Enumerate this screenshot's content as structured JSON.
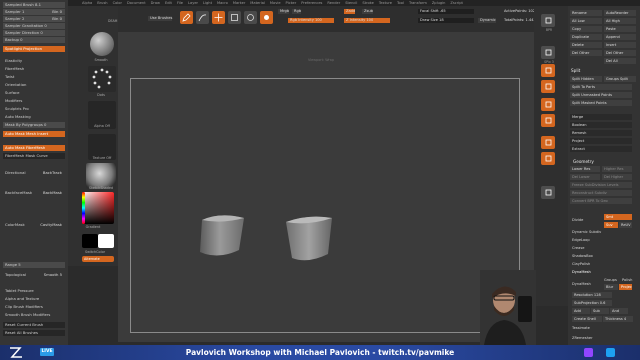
{
  "menu": [
    "Alpha",
    "Brush",
    "Color",
    "Document",
    "Draw",
    "Edit",
    "File",
    "Layer",
    "Light",
    "Macro",
    "Marker",
    "Material",
    "Movie",
    "Picker",
    "Preferences",
    "Render",
    "Stencil",
    "Stroke",
    "Texture",
    "Tool",
    "Transform",
    "Zplugin",
    "Zscript"
  ],
  "left_palette": [
    {
      "label": "Sampled Brush 8.1",
      "style": "slider",
      "value": ""
    },
    {
      "label": "Sampler 1",
      "style": "slider",
      "value": "Bin 0"
    },
    {
      "label": "Sampler 2",
      "style": "slider",
      "value": "Bin 0"
    },
    {
      "label": "Sampler Gravitation 0",
      "style": "slider",
      "value": ""
    },
    {
      "label": "Sampler Direction 0",
      "style": "slider",
      "value": ""
    },
    {
      "label": "Backup 0",
      "style": "slider",
      "value": ""
    },
    {
      "label": "Spotlight Projection",
      "style": "orange",
      "value": ""
    },
    {
      "label": "Elasticity",
      "style": "plain",
      "value": ""
    },
    {
      "label": "FiberMesh",
      "style": "plain",
      "value": ""
    },
    {
      "label": "Twist",
      "style": "plain",
      "value": ""
    },
    {
      "label": "Orientation",
      "style": "plain",
      "value": ""
    },
    {
      "label": "Surface",
      "style": "plain",
      "value": ""
    },
    {
      "label": "Modifiers",
      "style": "plain",
      "value": ""
    },
    {
      "label": "Sculptris Pro",
      "style": "plain",
      "value": ""
    },
    {
      "label": "Auto Masking",
      "style": "plain",
      "value": ""
    },
    {
      "label": "Mask By Polygroups 0",
      "style": "slider",
      "value": ""
    },
    {
      "label": "Auto Mask Mesh Insert",
      "style": "orange",
      "value": ""
    },
    {
      "label": "Auto Mask FiberMesh",
      "style": "orange",
      "value": ""
    },
    {
      "label": "FiberMesh Mask Curve",
      "style": "dark",
      "value": ""
    },
    {
      "label": "Directional",
      "style": "plain",
      "value": "BackTrack"
    },
    {
      "label": "BackfaceMask",
      "style": "plain",
      "value": "BackMask"
    },
    {
      "label": "ColorMask",
      "style": "plain",
      "value": "CavityMask"
    },
    {
      "label": "Range 5",
      "style": "slider",
      "value": ""
    },
    {
      "label": "Topological",
      "style": "plain",
      "value": "Smooth 5"
    },
    {
      "label": "Tablet Pressure",
      "style": "plain",
      "value": ""
    },
    {
      "label": "Alpha and Texture",
      "style": "plain",
      "value": ""
    },
    {
      "label": "Clip Brush Modifiers",
      "style": "plain",
      "value": ""
    },
    {
      "label": "Smooth Brush Modifiers",
      "style": "plain",
      "value": ""
    },
    {
      "label": "Reset Current Brush",
      "style": "dark",
      "value": ""
    },
    {
      "label": "Reset All Brushes",
      "style": "dark",
      "value": ""
    }
  ],
  "brush_column": {
    "current_label": "DEAM",
    "smooth_label": "Smooth",
    "polysphere_label": "PolySphere",
    "dots_label": "Dots",
    "alpha_label": "Alpha Off",
    "texture_label": "Texture Off",
    "material_label": "SketchShaded",
    "gradient_label": "Gradient",
    "switch_label": "SwitchColor",
    "alternate_label": "Alternate"
  },
  "shelf": {
    "use_brushes": "Use Brushes",
    "edit": "Edit",
    "draw": "Draw",
    "move": "Move",
    "scale": "Scale",
    "rotate": "Rotate",
    "mrgb": "Mrgb",
    "rgb": "Rgb",
    "m": "M",
    "zadd": "Zadd",
    "zsub": "Zsub",
    "zcut": "Zcut",
    "rgb_intensity": "Rgb Intensity 100",
    "z_intensity": "Z Intensity 100",
    "focal_shift": "Focal Shift -65",
    "draw_size": "Draw Size 18",
    "dynamic": "Dynamic",
    "active_points": "ActivePoints: 102",
    "total_points": "TotalPoints: 1.443 Mil"
  },
  "viewport_hint": "Viewport: Wrap",
  "right_strip": [
    {
      "label": "BPR",
      "style": "grey"
    },
    {
      "label": "SPix 3",
      "style": "grey"
    },
    {
      "label": "",
      "style": "orange"
    },
    {
      "label": "",
      "style": "orange"
    },
    {
      "label": "",
      "style": "orange"
    },
    {
      "label": "",
      "style": "orange"
    },
    {
      "label": "",
      "style": "orange"
    },
    {
      "label": "",
      "style": "orange"
    },
    {
      "label": "",
      "style": "grey"
    }
  ],
  "right_palette": {
    "top_buttons": [
      [
        "Rename",
        "AutoReorder"
      ],
      [
        "All Low",
        "All High"
      ],
      [
        "Copy",
        "Paste"
      ],
      [
        "Duplicate",
        "Append"
      ],
      [
        "Delete",
        "Insert"
      ],
      [
        "Del Other",
        "Del Other"
      ],
      [
        "",
        "Del All"
      ]
    ],
    "split_heading": "Split",
    "split_items": [
      "Split Hidden",
      "Groups Split",
      "Split To Parts",
      "Split Unmasked Points",
      "Split Masked Points"
    ],
    "merge_items": [
      "Merge",
      "Boolean",
      "Remesh",
      "Project",
      "Extract"
    ],
    "geometry_heading": "Geometry",
    "geometry_items": [
      "Lower Res",
      "Higher Res",
      "Del Lower",
      "Del Higher",
      "Freeze SubDivision Levels",
      "Reconstruct Subdiv",
      "Convert BPR To Geo"
    ],
    "divide": "Divide",
    "smt": "Smt",
    "suv": "Suv",
    "rsmt": "ReUV",
    "dynamic_subdiv": "Dynamic Subdiv",
    "edgeloop": "EdgeLoop",
    "crease": "Crease",
    "shadowbox": "ShadowBox",
    "claypolish": "ClayPolish",
    "dynamesh_heading": "DynaMesh",
    "dynamesh": "DynaMesh",
    "groups": "Groups",
    "polish": "Polish",
    "blur": "Blur",
    "project": "Project",
    "resolution": "Resolution 128",
    "subprojection": "SubProjection 0.6",
    "add": "Add",
    "sub": "Sub",
    "and": "And",
    "create_shell": "Create Shell",
    "thickness": "Thickness 4",
    "tessimate": "Tessimate",
    "zremesher": "ZRemesher"
  },
  "banner": {
    "live": "LIVE",
    "title": "Pavlovich Workshop with Michael Pavlovich - twitch.tv/pavmike"
  },
  "colors": {
    "accent": "#d4661f",
    "banner": "#2a4aa3",
    "twitch": "#9146ff",
    "twitter": "#1da1f2"
  }
}
